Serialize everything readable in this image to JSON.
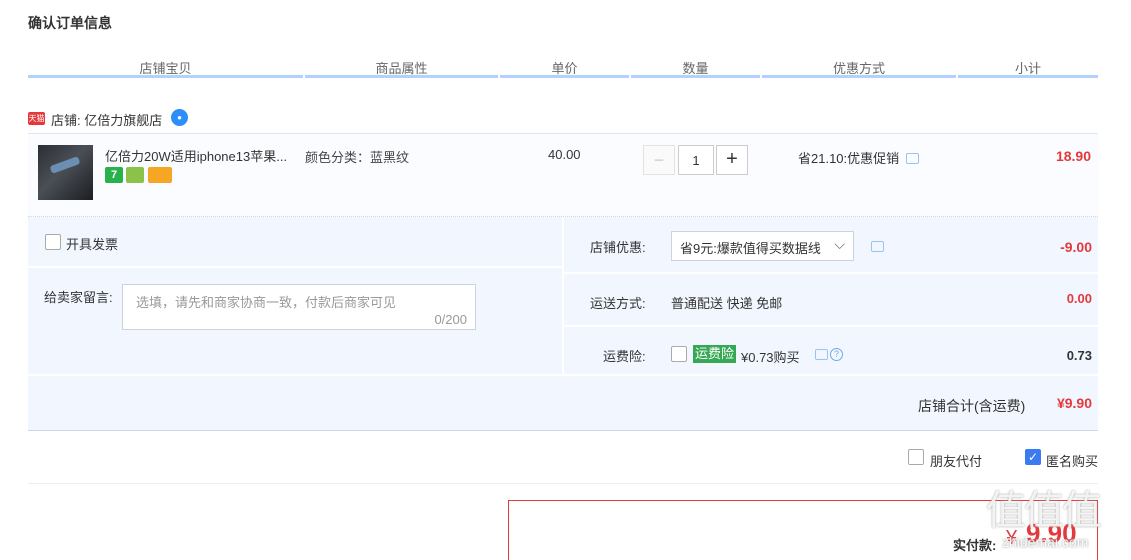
{
  "page_title": "确认订单信息",
  "columns": [
    "店铺宝贝",
    "商品属性",
    "单价",
    "数量",
    "优惠方式",
    "小计"
  ],
  "shop": {
    "tag": "天猫",
    "name": "店铺: 亿倍力旗舰店"
  },
  "item": {
    "name": "亿倍力20W适用iphone13苹果...",
    "badge_7": "7",
    "property": "颜色分类：蓝黑纹",
    "price": "40.00",
    "quantity": "1",
    "qty_minus": "−",
    "qty_plus": "+",
    "promo": "省21.10:优惠促销",
    "subtotal": "18.90"
  },
  "invoice": {
    "label": "开具发票"
  },
  "message": {
    "label": "给卖家留言:",
    "placeholder": "选填，请先和商家协商一致，付款后商家可见",
    "counter": "0/200"
  },
  "shop_discount": {
    "label": "店铺优惠:",
    "selected": "省9元:爆款值得买数据线",
    "amount": "-9.00"
  },
  "shipping": {
    "label": "运送方式:",
    "method": "普通配送 快递 免邮",
    "amount": "0.00"
  },
  "insurance": {
    "label": "运费险:",
    "tag": "运费险",
    "price": "¥0.73购买",
    "amount": "0.73"
  },
  "shop_total": {
    "label": "店铺合计(含运费)",
    "amount": "¥9.90"
  },
  "options": {
    "friend_pay": "朋友代付",
    "anonymous": "匿名购买",
    "anonymous_checked": true
  },
  "payment": {
    "label": "实付款:",
    "currency": "¥",
    "amount": "9.90"
  },
  "watermark": {
    "logo": "值值值",
    "url": "zhidemai.com"
  },
  "colors": {
    "accent_red": "#e4393c",
    "header_line": "#b2d1ff",
    "panel_bg": "#f2f7ff",
    "check_blue": "#3a7cf0"
  }
}
